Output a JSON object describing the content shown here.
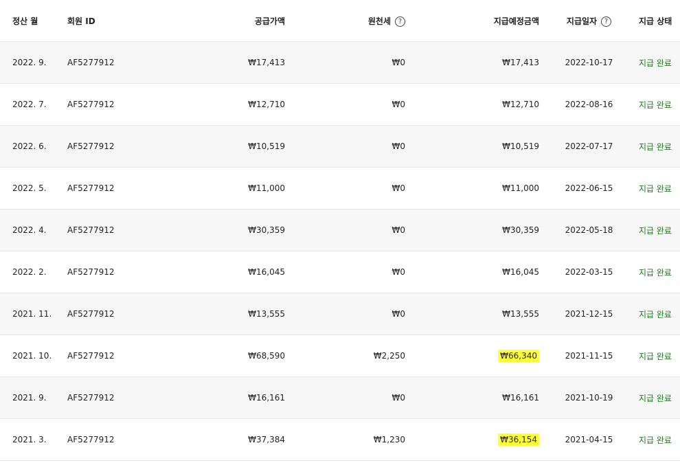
{
  "colors": {
    "status": "#1e7b1e",
    "highlight": "#ffff3a"
  },
  "headers": {
    "month": "정산 월",
    "member_id": "회원 ID",
    "supply": "공급가액",
    "withholding": "원천세",
    "scheduled": "지급예정금액",
    "pay_date": "지급일자",
    "status": "지급 상태"
  },
  "help_icon": "question-circle-icon",
  "help_glyph": "?",
  "rows": [
    {
      "month": "2022. 9.",
      "member_id": "AF5277912",
      "supply": "₩17,413",
      "withholding": "₩0",
      "scheduled": "₩17,413",
      "pay_date": "2022-10-17",
      "status": "지급 완료",
      "highlighted": false
    },
    {
      "month": "2022. 7.",
      "member_id": "AF5277912",
      "supply": "₩12,710",
      "withholding": "₩0",
      "scheduled": "₩12,710",
      "pay_date": "2022-08-16",
      "status": "지급 완료",
      "highlighted": false
    },
    {
      "month": "2022. 6.",
      "member_id": "AF5277912",
      "supply": "₩10,519",
      "withholding": "₩0",
      "scheduled": "₩10,519",
      "pay_date": "2022-07-17",
      "status": "지급 완료",
      "highlighted": false
    },
    {
      "month": "2022. 5.",
      "member_id": "AF5277912",
      "supply": "₩11,000",
      "withholding": "₩0",
      "scheduled": "₩11,000",
      "pay_date": "2022-06-15",
      "status": "지급 완료",
      "highlighted": false
    },
    {
      "month": "2022. 4.",
      "member_id": "AF5277912",
      "supply": "₩30,359",
      "withholding": "₩0",
      "scheduled": "₩30,359",
      "pay_date": "2022-05-18",
      "status": "지급 완료",
      "highlighted": false
    },
    {
      "month": "2022. 2.",
      "member_id": "AF5277912",
      "supply": "₩16,045",
      "withholding": "₩0",
      "scheduled": "₩16,045",
      "pay_date": "2022-03-15",
      "status": "지급 완료",
      "highlighted": false
    },
    {
      "month": "2021. 11.",
      "member_id": "AF5277912",
      "supply": "₩13,555",
      "withholding": "₩0",
      "scheduled": "₩13,555",
      "pay_date": "2021-12-15",
      "status": "지급 완료",
      "highlighted": false
    },
    {
      "month": "2021. 10.",
      "member_id": "AF5277912",
      "supply": "₩68,590",
      "withholding": "₩2,250",
      "scheduled": "₩66,340",
      "pay_date": "2021-11-15",
      "status": "지급 완료",
      "highlighted": true
    },
    {
      "month": "2021. 9.",
      "member_id": "AF5277912",
      "supply": "₩16,161",
      "withholding": "₩0",
      "scheduled": "₩16,161",
      "pay_date": "2021-10-19",
      "status": "지급 완료",
      "highlighted": false
    },
    {
      "month": "2021. 3.",
      "member_id": "AF5277912",
      "supply": "₩37,384",
      "withholding": "₩1,230",
      "scheduled": "₩36,154",
      "pay_date": "2021-04-15",
      "status": "지급 완료",
      "highlighted": true
    }
  ]
}
